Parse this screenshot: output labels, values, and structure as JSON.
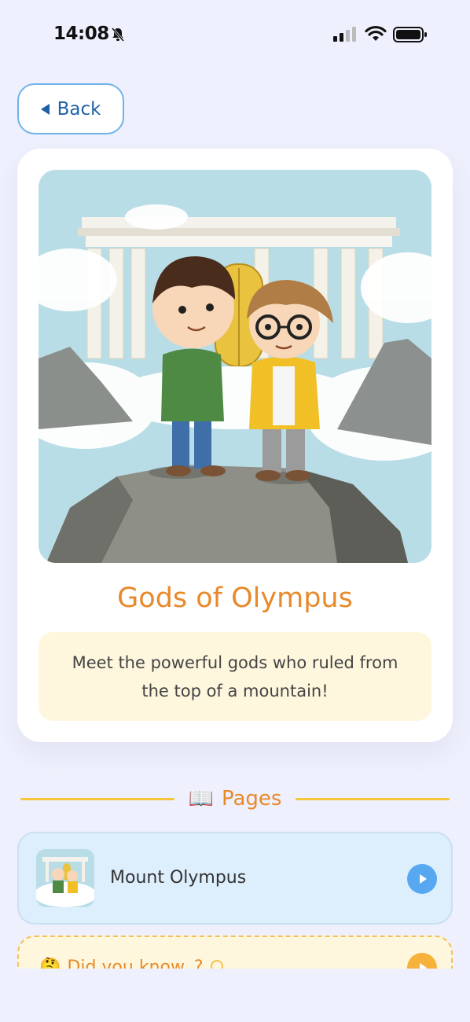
{
  "status_bar": {
    "time": "14:08",
    "icons": [
      "bell-slash-icon",
      "cellular-signal-icon",
      "wifi-icon",
      "battery-icon"
    ]
  },
  "nav": {
    "back_label": "Back",
    "back_icon": "triangle-left-icon"
  },
  "hero": {
    "title": "Gods of Olympus",
    "description": "Meet the powerful gods who ruled from the top of a mountain!",
    "illustration": "two-boys-on-mountain-top-before-olympus-temple"
  },
  "pages_section": {
    "icon": "📖",
    "label": "Pages"
  },
  "pages": [
    {
      "label": "Mount Olympus",
      "thumbnail": "olympus-thumbnail",
      "action_icon": "play-icon"
    }
  ],
  "did_you_know": {
    "label": "Did you know..?",
    "icon": "🤔",
    "trailing_icon": "lightbulb-icon",
    "action_icon": "play-icon"
  },
  "colors": {
    "background": "#eef0fd",
    "accent_orange": "#e8892a",
    "back_blue": "#1f5fa8",
    "play_blue": "#57a8f0",
    "divider_yellow": "#f7c53a"
  }
}
